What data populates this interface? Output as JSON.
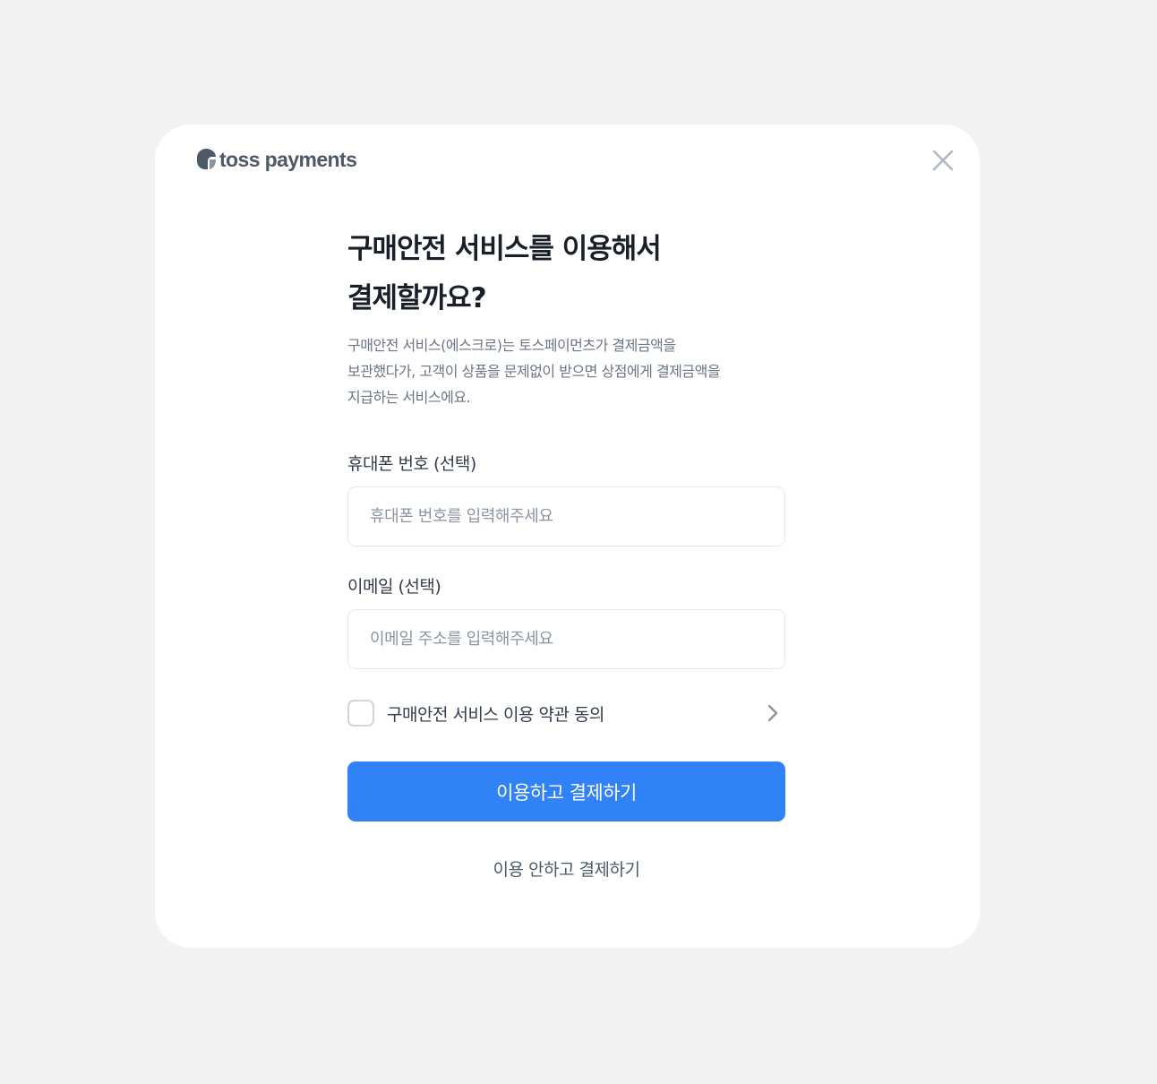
{
  "brand": {
    "logo_text": "toss payments",
    "logo_icon": "toss-logo-icon"
  },
  "header": {
    "close_icon": "close-icon"
  },
  "main": {
    "title_lines": [
      "구매안전 서비스를 이용해서",
      "결제할까요?"
    ],
    "description_lines": [
      "구매안전 서비스(에스크로)는 토스페이먼츠가 결제금액을",
      "보관했다가, 고객이 상품을 문제없이 받으면 상점에게 결제금액을",
      "지급하는 서비스에요."
    ],
    "phone": {
      "label": "휴대폰 번호 (선택)",
      "value": "",
      "placeholder": "휴대폰 번호를 입력해주세요"
    },
    "email": {
      "label": "이메일 (선택)",
      "value": "",
      "placeholder": "이메일 주소를 입력해주세요"
    },
    "agreement": {
      "label": "구매안전 서비스 이용 약관 동의",
      "chevron_icon": "chevron-right-icon"
    },
    "primary_button": "이용하고 결제하기",
    "secondary_button": "이용 안하고 결제하기"
  },
  "colors": {
    "background": "#f2f2f2",
    "modal": "#ffffff",
    "primary": "#3182f6",
    "title": "#191f28",
    "body_text": "#6b7684",
    "label_text": "#333d4b",
    "placeholder": "#8b95a1",
    "border": "#e5e8eb",
    "icon_gray": "#b0b8c1"
  }
}
